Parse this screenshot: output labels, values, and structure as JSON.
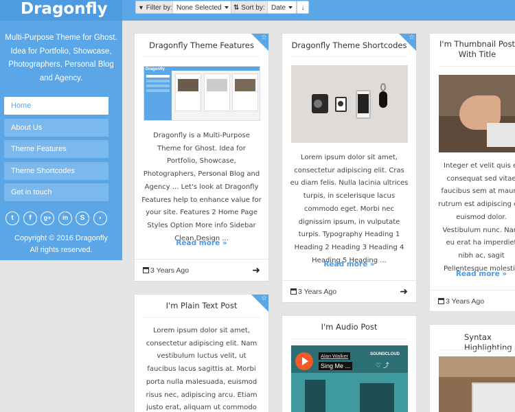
{
  "brand": {
    "name": "Dragonfly"
  },
  "toolbar": {
    "filter_label": "Filter by:",
    "filter_value": "None Selected",
    "sort_label": "Sort by:",
    "sort_value": "Date",
    "sort_direction_icon": "arrow-down-icon"
  },
  "sidebar": {
    "tagline": "Multi-Purpose Theme for Ghost. Idea for Portfolio, Showcase, Photographers, Personal Blog and Agency.",
    "nav": [
      "Home",
      "About Us",
      "Theme Features",
      "Theme Shortcodes",
      "Get in touch"
    ],
    "active_index": 0,
    "social": [
      "twitter-icon",
      "facebook-icon",
      "google-plus-icon",
      "linkedin-icon",
      "skype-icon",
      "rss-icon"
    ],
    "copyright_line1": "Copyright © 2016 Dragonfly",
    "copyright_line2": "All rights reserved."
  },
  "cards": [
    {
      "title": "Dragonfly Theme Features",
      "featured": true,
      "excerpt": "Dragonfly is a Multi-Purpose Theme for Ghost. Idea for Portfolio, Showcase, Photographers, Personal Blog and Agency ... Let's look at Dragonfly Features help to enhance value for your site. Features 2 Home Page Styles Option More info Sidebar Clean Design ...",
      "read_more": "Read more »",
      "date": "3 Years Ago",
      "image_brand": "Dragonfly"
    },
    {
      "title": "Dragonfly Theme Shortcodes",
      "featured": true,
      "excerpt": "Lorem ipsum dolor sit amet, consectetur adipiscing elit. Cras eu diam felis. Nulla lacinia ultrices turpis, in scelerisque lacus commodo eget. Morbi nec dignissim ipsum, in vulputate turpis. Typography Heading 1 Heading 2 Heading 3 Heading 4 Heading 5 Heading ...",
      "read_more": "Read more »",
      "date": "3 Years Ago"
    },
    {
      "title": "I'm Thumbnail Post With Title",
      "featured": false,
      "excerpt": "Integer et velit quis el consequat sed vitae faucibus sem at mauris rutrum est adipiscing elit euismod dolor. Vestibulum nunc. Nam eu erat ha imperdiet nibh ac, sagit Pellentesque molestie",
      "read_more": "Read more »",
      "date": "3 Years Ago"
    },
    {
      "title": "I'm Plain Text Post",
      "featured": true,
      "excerpt": "Lorem ipsum dolor sit amet, consectetur adipiscing elit. Nam vestibulum luctus velit, ut faucibus lacus sagittis at. Morbi porta nulla malesuada, euismod risus nec, adipiscing arcu. Etiam justo erat, aliquam ut commodo eget, lobortis at"
    },
    {
      "title": "I'm Audio Post",
      "featured": false,
      "player": {
        "artist": "Alan Walker",
        "track": "Sing Me ...",
        "service": "SOUNDCLOUD"
      }
    },
    {
      "title": "Syntax Highlighting",
      "featured": false
    }
  ]
}
